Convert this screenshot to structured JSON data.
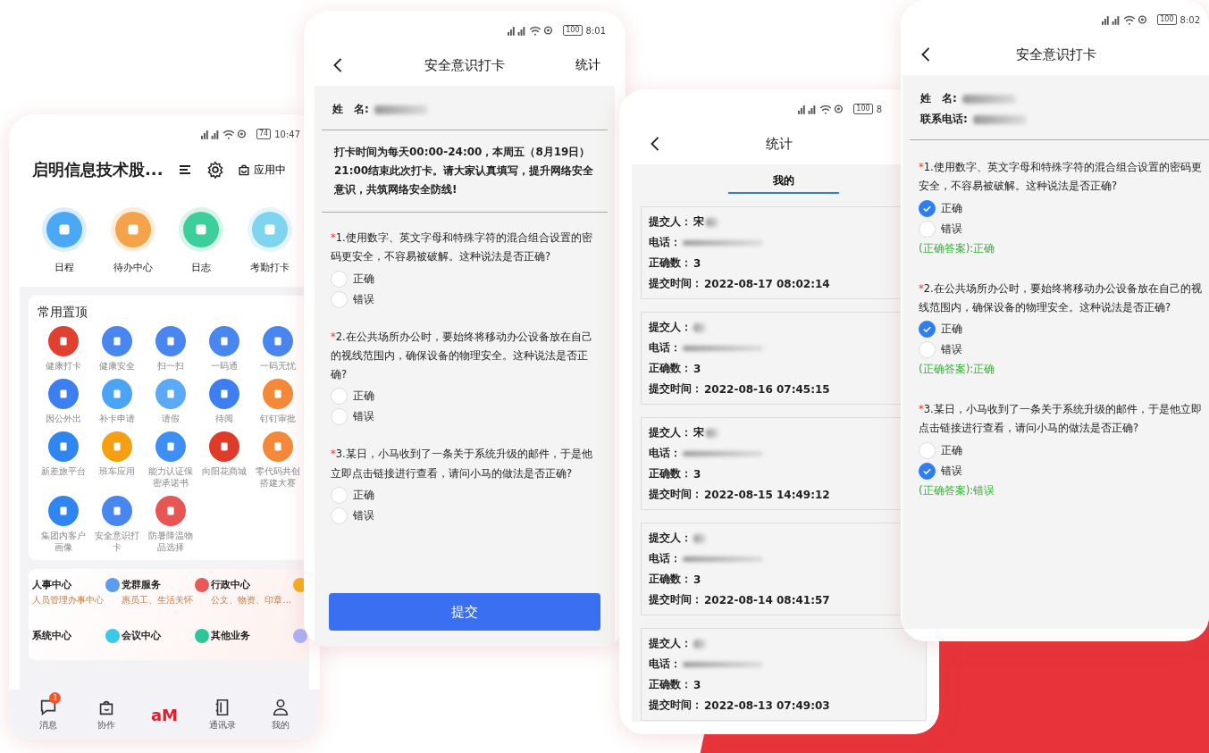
{
  "phones": [
    {
      "kind": "home",
      "status": {
        "time": "10:47",
        "battery": "74"
      },
      "title": "启明信息技术股...",
      "app_center": "应用中",
      "quick": [
        {
          "label": "日程",
          "color": "#4aa8f5"
        },
        {
          "label": "待办中心",
          "color": "#f5a34a"
        },
        {
          "label": "日志",
          "color": "#3ccf9a"
        },
        {
          "label": "考勤打卡",
          "color": "#7fd4f0"
        }
      ],
      "pinned": {
        "title": "常用置顶",
        "apps": [
          {
            "label": "健康打卡",
            "color": "#e0402f"
          },
          {
            "label": "健康安全",
            "color": "#4a86f0"
          },
          {
            "label": "扫一扫",
            "color": "#4a86f0"
          },
          {
            "label": "一码通",
            "color": "#4a86f0"
          },
          {
            "label": "一码无忧",
            "color": "#4a86f0"
          },
          {
            "label": "因公外出",
            "color": "#3d7ff0"
          },
          {
            "label": "补卡申请",
            "color": "#4aa3f5"
          },
          {
            "label": "请假",
            "color": "#5aaaf5"
          },
          {
            "label": "待阅",
            "color": "#3d7ff0"
          },
          {
            "label": "钉钉审批",
            "color": "#f5893a"
          },
          {
            "label": "新差旅平台",
            "color": "#2f86f0"
          },
          {
            "label": "班车应用",
            "color": "#f5a013"
          },
          {
            "label": "能力认证保密承诺书",
            "color": "#3d8ff5"
          },
          {
            "label": "向阳花商城",
            "color": "#e03a2a"
          },
          {
            "label": "零代码共创搭建大赛",
            "color": "#f5893a"
          },
          {
            "label": "集团内客户画像",
            "color": "#2f86f0"
          },
          {
            "label": "安全意识打卡",
            "color": "#4a86f0"
          },
          {
            "label": "防暑降温物品选择",
            "color": "#e85555"
          }
        ]
      },
      "business": [
        {
          "title": "人事中心",
          "subtitle": "人员管理办事中心",
          "color": "#5b9cf0"
        },
        {
          "title": "党群服务",
          "subtitle": "惠员工、生活关怀",
          "color": "#e85a5a"
        },
        {
          "title": "行政中心",
          "subtitle": "公文、物资、印章...",
          "color": "#f5b020"
        },
        {
          "title": "系统中心",
          "color": "#3cc8e8"
        },
        {
          "title": "会议中心",
          "color": "#2fc59a"
        },
        {
          "title": "其他业务",
          "color": "#aab4f5"
        }
      ],
      "tabbar": [
        {
          "label": "消息",
          "badge": "1",
          "kind": "chat"
        },
        {
          "label": "协作",
          "kind": "bag"
        },
        {
          "logo": "aM",
          "kind": "logo"
        },
        {
          "label": "通讯录",
          "kind": "book"
        },
        {
          "label": "我的",
          "kind": "user"
        }
      ]
    },
    {
      "kind": "quiz",
      "status": {
        "time": "8:01",
        "battery": "100"
      },
      "title": "安全意识打卡",
      "action": "统计",
      "info": [
        {
          "label": "姓　名:"
        }
      ],
      "notice": "打卡时间为每天00:00-24:00，本周五（8月19日）21:00结束此次打卡。请大家认真填写，提升网络安全意识，共筑网络安全防线!",
      "questions": [
        {
          "mark": "*",
          "text": "1.使用数字、英文字母和特殊字符的混合组合设置的密码更安全，不容易被破解。这种说法是否正确?",
          "options": [
            {
              "label": "正确",
              "selected": false
            },
            {
              "label": "错误",
              "selected": false
            }
          ]
        },
        {
          "mark": "*",
          "text": "2.在公共场所办公时，要始终将移动办公设备放在自己的视线范围内，确保设备的物理安全。这种说法是否正确?",
          "options": [
            {
              "label": "正确",
              "selected": false
            },
            {
              "label": "错误",
              "selected": false
            }
          ]
        },
        {
          "mark": "*",
          "text": "3.某日，小马收到了一条关于系统升级的邮件，于是他立即点击链接进行查看，请问小马的做法是否正确?",
          "options": [
            {
              "label": "正确",
              "selected": false
            },
            {
              "label": "错误",
              "selected": false
            }
          ]
        }
      ],
      "submit": "提交"
    },
    {
      "kind": "stats",
      "status": {
        "time": "8",
        "battery": "100"
      },
      "title": "统计",
      "tabs": [
        {
          "label": "我的",
          "selected": true
        }
      ],
      "records": [
        {
          "submitter_label": "提交人：",
          "submitter": "宋",
          "phone_label": "电话：",
          "score_label": "正确数：",
          "score": "3",
          "time_label": "提交时间：",
          "time": "2022-08-17 08:02:14"
        },
        {
          "submitter_label": "提交人：",
          "phone_label": "电话：",
          "score_label": "正确数：",
          "score": "3",
          "time_label": "提交时间：",
          "time": "2022-08-16 07:45:15"
        },
        {
          "submitter_label": "提交人：",
          "submitter": "宋",
          "phone_label": "电话：",
          "score_label": "正确数：",
          "score": "3",
          "time_label": "提交时间：",
          "time": "2022-08-15 14:49:12"
        },
        {
          "submitter_label": "提交人：",
          "phone_label": "电话：",
          "score_label": "正确数：",
          "score": "3",
          "time_label": "提交时间：",
          "time": "2022-08-14 08:41:57"
        },
        {
          "submitter_label": "提交人：",
          "phone_label": "电话：",
          "score_label": "正确数：",
          "score": "3",
          "time_label": "提交时间：",
          "time": "2022-08-13 07:49:03"
        }
      ]
    },
    {
      "kind": "quiz",
      "status": {
        "time": "8:02",
        "battery": "100"
      },
      "title": "安全意识打卡",
      "info": [
        {
          "label": "姓　名:"
        },
        {
          "label": "联系电话:"
        }
      ],
      "questions": [
        {
          "mark": "*",
          "text": "1.使用数字、英文字母和特殊字符的混合组合设置的密码更安全，不容易被破解。这种说法是否正确?",
          "options": [
            {
              "label": "正确",
              "selected": true
            },
            {
              "label": "错误",
              "selected": false
            }
          ],
          "answer": "(正确答案):正确"
        },
        {
          "mark": "*",
          "text": "2.在公共场所办公时，要始终将移动办公设备放在自己的视线范围内，确保设备的物理安全。这种说法是否正确?",
          "options": [
            {
              "label": "正确",
              "selected": true
            },
            {
              "label": "错误",
              "selected": false
            }
          ],
          "answer": "(正确答案):正确"
        },
        {
          "mark": "*",
          "text": "3.某日，小马收到了一条关于系统升级的邮件，于是他立即点击链接进行查看，请问小马的做法是否正确?",
          "options": [
            {
              "label": "正确",
              "selected": false
            },
            {
              "label": "错误",
              "selected": true
            }
          ],
          "answer": "(正确答案):错误"
        }
      ]
    }
  ]
}
